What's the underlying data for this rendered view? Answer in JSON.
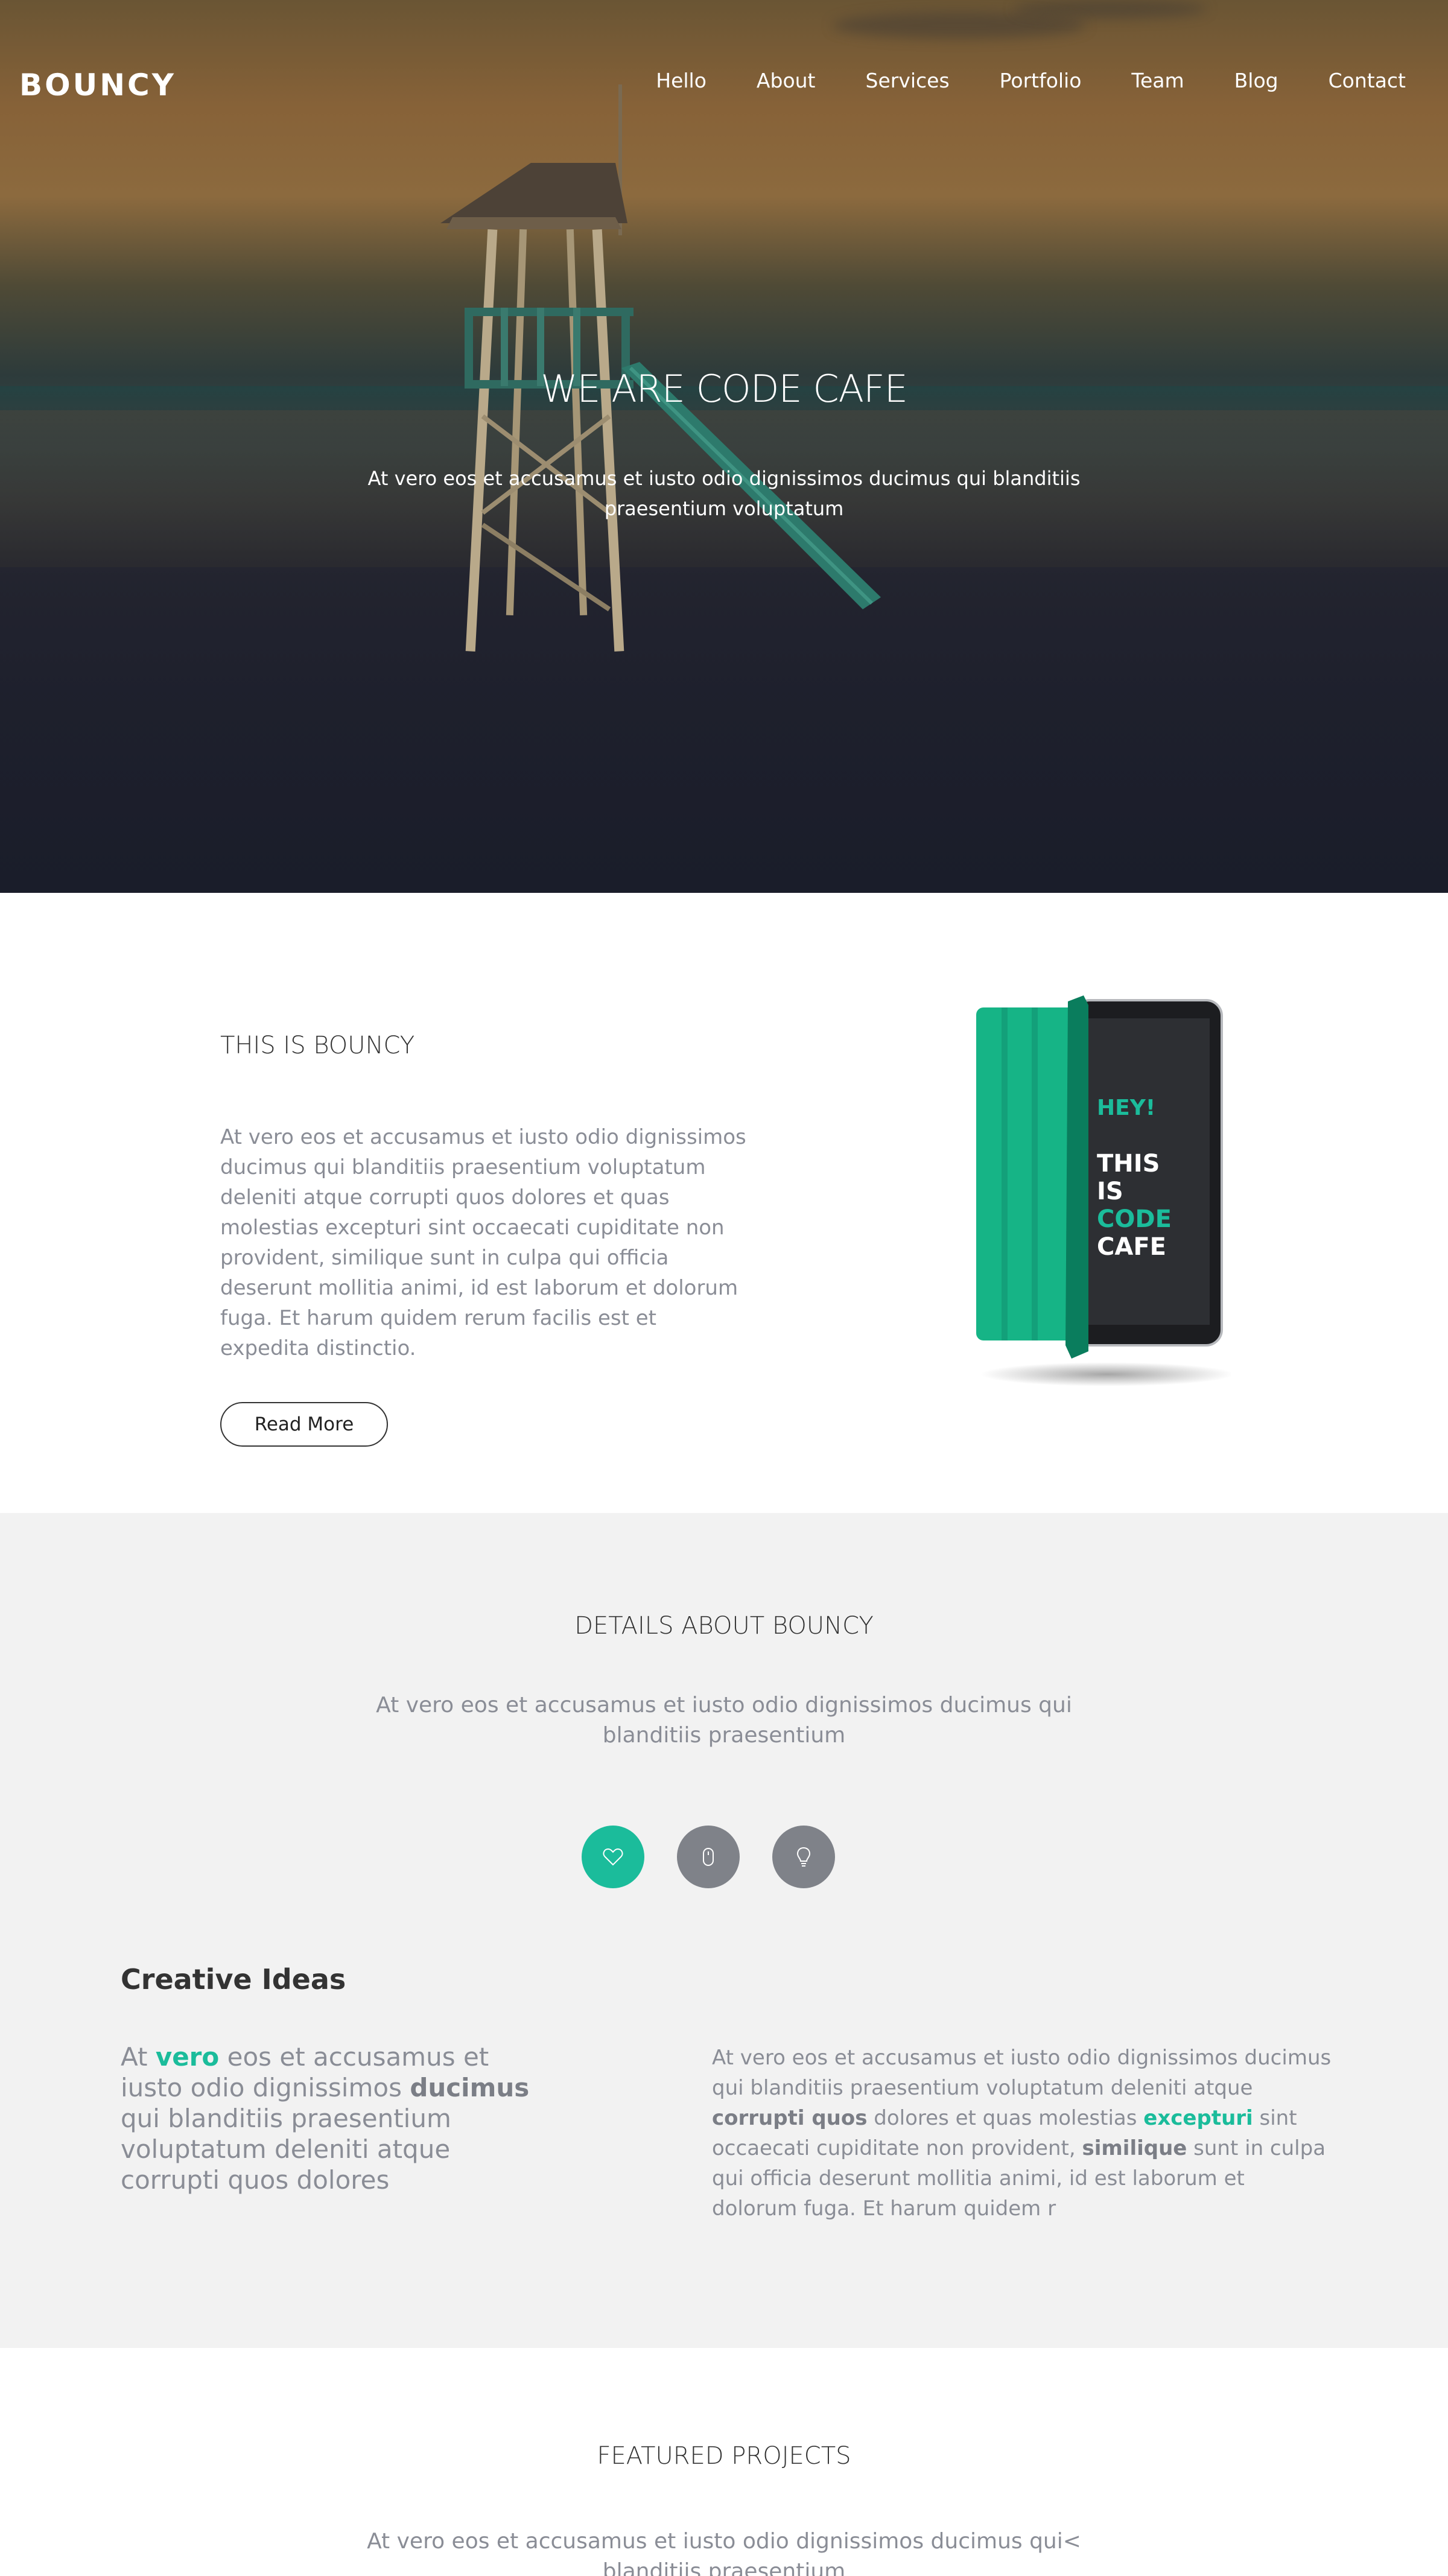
{
  "brand": {
    "logo": "BOUNCY"
  },
  "nav": {
    "items": [
      "Hello",
      "About",
      "Services",
      "Portfolio",
      "Team",
      "Blog",
      "Contact"
    ]
  },
  "hero": {
    "title": "WE ARE CODE CAFE",
    "subtitle": "At vero eos et accusamus et iusto odio dignissimos ducimus qui blanditiis praesentium voluptatum"
  },
  "about": {
    "title": "THIS IS BOUNCY",
    "text": "At vero eos et accusamus et iusto odio dignissimos ducimus qui blanditiis praesentium voluptatum deleniti atque corrupti quos dolores et quas molestias excepturi sint occaecati cupiditate non provident, similique sunt in culpa qui officia deserunt mollitia animi, id est laborum et dolorum fuga. Et harum quidem rerum facilis est et expedita distinctio.",
    "button": "Read More",
    "tablet_screen": {
      "line1": "HEY!",
      "line2": "THIS",
      "line3": "IS",
      "line4": "CODE",
      "line5": "CAFE"
    }
  },
  "details": {
    "title": "DETAILS ABOUT BOUNCY",
    "subtitle": "At vero eos et accusamus et iusto odio dignissimos ducimus qui blanditiis praesentium",
    "icons": [
      {
        "name": "heart-icon",
        "active": true
      },
      {
        "name": "mouse-icon",
        "active": false
      },
      {
        "name": "lightbulb-icon",
        "active": false
      }
    ],
    "creative_title": "Creative Ideas",
    "left": {
      "p1": "At ",
      "h1": "vero",
      "p2": " eos et accusamus et iusto odio dignissimos ",
      "h2": "ducimus",
      "p3": " qui blanditiis praesentium voluptatum deleniti atque corrupti quos dolores"
    },
    "right": {
      "p1": "At vero eos et accusamus et iusto odio dignissimos ducimus qui blanditiis praesentium voluptatum deleniti atque ",
      "h1": "corrupti quos",
      "p2": " dolores et quas molestias ",
      "h2": "excepturi",
      "p3": " sint occaecati cupiditate non provident, ",
      "h3": "similique",
      "p4": " sunt in culpa qui officia deserunt mollitia animi, id est laborum et dolorum fuga. Et harum quidem r"
    }
  },
  "featured": {
    "title": "FEATURED PROJECTS",
    "subtitle": "At vero eos et accusamus et iusto odio dignissimos ducimus qui< blanditiis praesentium"
  },
  "colors": {
    "accent": "#1bbc9b",
    "icon_grey": "#7f8289",
    "text_grey": "#8a8d96",
    "section_bg": "#f2f2f2"
  }
}
